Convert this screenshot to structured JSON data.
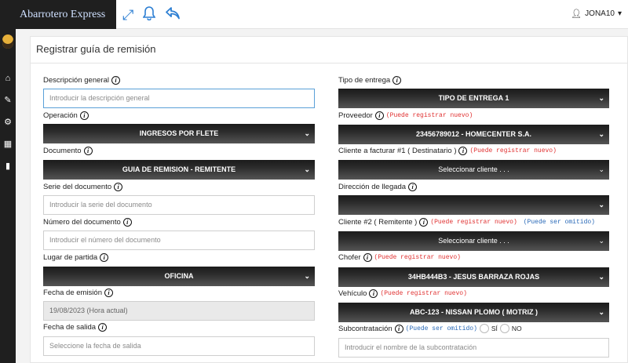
{
  "header": {
    "brand": "Abarrotero Express",
    "user": "JONA10",
    "icons": [
      "expand-icon",
      "bell-icon",
      "reply-icon"
    ]
  },
  "page_title": "Registrar guía de remisión",
  "notes": {
    "register": "(Puede registrar nuevo)",
    "omit": "(Puede ser omitido)"
  },
  "left": {
    "descripcion": {
      "label": "Descripción general",
      "placeholder": "Introducir la descripción general"
    },
    "operacion": {
      "label": "Operación",
      "value": "INGRESOS POR FLETE"
    },
    "documento": {
      "label": "Documento",
      "value": "GUIA DE REMISION - REMITENTE"
    },
    "serie": {
      "label": "Serie del documento",
      "placeholder": "Introducir la serie del documento"
    },
    "numero": {
      "label": "Número del documento",
      "placeholder": "Introducir el número del documento"
    },
    "lugar": {
      "label": "Lugar de partida",
      "value": "OFICINA"
    },
    "emision": {
      "label": "Fecha de emisión",
      "value": "19/08/2023 (Hora actual)"
    },
    "salida": {
      "label": "Fecha de salida",
      "placeholder": "Seleccione la fecha de salida"
    }
  },
  "right": {
    "tipo": {
      "label": "Tipo de entrega",
      "value": "TIPO DE ENTREGA 1"
    },
    "proveedor": {
      "label": "Proveedor",
      "value": "23456789012 - HOMECENTER S.A."
    },
    "cliente1": {
      "label": "Cliente a facturar #1 ( Destinatario )",
      "value": "Seleccionar cliente . . ."
    },
    "direccion": {
      "label": "Dirección de llegada",
      "value": ""
    },
    "cliente2": {
      "label": "Cliente #2 ( Remitente )",
      "value": "Seleccionar cliente . . ."
    },
    "chofer": {
      "label": "Chofer",
      "value": "34HB444B3 - JESUS BARRAZA ROJAS"
    },
    "vehiculo": {
      "label": "Vehículo",
      "value": "ABC-123 - NISSAN PLOMO ( MOTRIZ )"
    },
    "subcontratacion": {
      "label": "Subcontratación",
      "yes": "SÍ",
      "no": "NO",
      "placeholder": "Introducir el nombre de la subcontratación"
    }
  }
}
